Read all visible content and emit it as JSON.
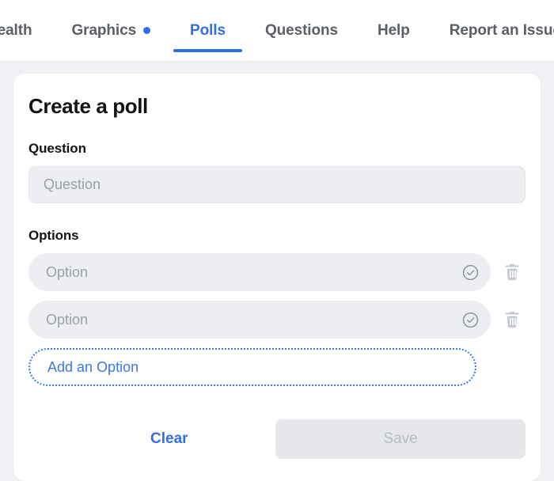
{
  "tabs": [
    {
      "label": "Health",
      "active": false,
      "dot": false
    },
    {
      "label": "Graphics",
      "active": false,
      "dot": true
    },
    {
      "label": "Polls",
      "active": true,
      "dot": false
    },
    {
      "label": "Questions",
      "active": false,
      "dot": false
    },
    {
      "label": "Help",
      "active": false,
      "dot": false
    },
    {
      "label": "Report an Issue",
      "active": false,
      "dot": false
    }
  ],
  "card": {
    "title": "Create a poll",
    "question_label": "Question",
    "question_value": "",
    "question_placeholder": "Question",
    "options_label": "Options",
    "options": [
      {
        "value": "",
        "placeholder": "Option"
      },
      {
        "value": "",
        "placeholder": "Option"
      }
    ],
    "add_option_label": "Add an Option",
    "clear_label": "Clear",
    "save_label": "Save"
  },
  "icons": {
    "check_circle": "check-circle-icon",
    "trash": "trash-icon",
    "tab_dot": "notification-dot-icon"
  },
  "colors": {
    "accent_blue": "#2f6fe4",
    "link_blue": "#3b78e7",
    "page_bg": "#eff1f5",
    "card_bg": "#ffffff",
    "field_bg": "#eceef1",
    "placeholder": "#9aa0a6",
    "disabled_button_bg": "#e5e7eb",
    "disabled_button_text": "#b7bcc3",
    "trash_gray": "#c5cad1",
    "check_gray": "#8f969e"
  }
}
